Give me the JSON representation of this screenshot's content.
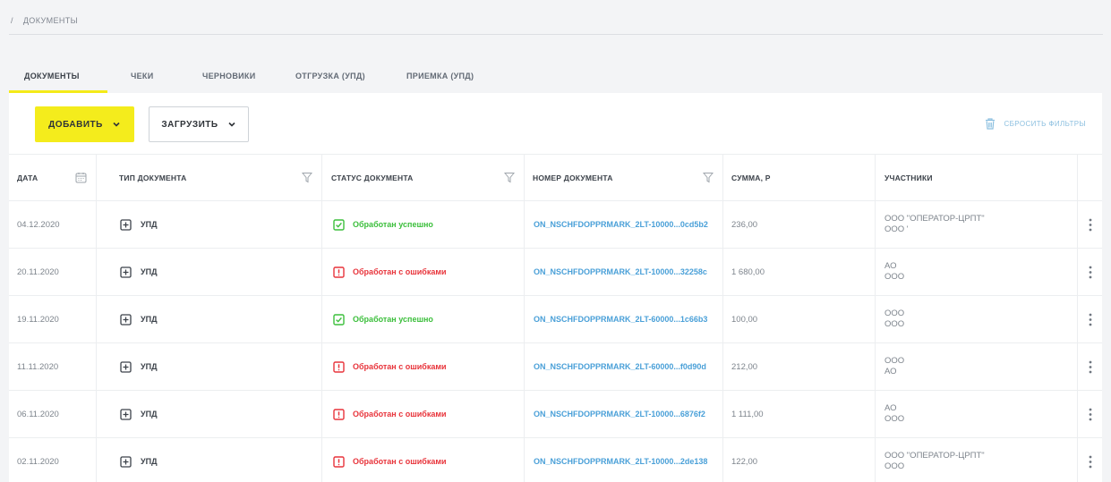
{
  "breadcrumb": {
    "separator": "/",
    "current": "ДОКУМЕНТЫ"
  },
  "tabs": [
    {
      "label": "ДОКУМЕНТЫ",
      "active": true
    },
    {
      "label": "ЧЕКИ",
      "active": false
    },
    {
      "label": "ЧЕРНОВИКИ",
      "active": false
    },
    {
      "label": "ОТГРУЗКА (УПД)",
      "active": false
    },
    {
      "label": "ПРИЕМКА (УПД)",
      "active": false
    }
  ],
  "toolbar": {
    "add_label": "ДОБАВИТЬ",
    "load_label": "ЗАГРУЗИТЬ",
    "reset_label": "СБРОСИТЬ ФИЛЬТРЫ"
  },
  "columns": {
    "date": "ДАТА",
    "type": "ТИП ДОКУМЕНТА",
    "status": "СТАТУС ДОКУМЕНТА",
    "number": "НОМЕР ДОКУМЕНТА",
    "sum": "СУММА, Р",
    "participants": "УЧАСТНИКИ"
  },
  "rows": [
    {
      "date": "04.12.2020",
      "type": "УПД",
      "status": "Обработан успешно",
      "status_kind": "ok",
      "number": "ON_NSCHFDOPPRMARK_2LT-10000...0cd5b2",
      "sum": "236,00",
      "p1": "ООО \"ОПЕРАТОР-ЦРПТ\"",
      "p2": "ООО '"
    },
    {
      "date": "20.11.2020",
      "type": "УПД",
      "status": "Обработан с ошибками",
      "status_kind": "error",
      "number": "ON_NSCHFDOPPRMARK_2LT-10000...32258c",
      "sum": "1 680,00",
      "p1": "АО",
      "p2": "ООО"
    },
    {
      "date": "19.11.2020",
      "type": "УПД",
      "status": "Обработан успешно",
      "status_kind": "ok",
      "number": "ON_NSCHFDOPPRMARK_2LT-60000...1c66b3",
      "sum": "100,00",
      "p1": "ООО",
      "p2": "ООО"
    },
    {
      "date": "11.11.2020",
      "type": "УПД",
      "status": "Обработан с ошибками",
      "status_kind": "error",
      "number": "ON_NSCHFDOPPRMARK_2LT-60000...f0d90d",
      "sum": "212,00",
      "p1": "ООО",
      "p2": "АО"
    },
    {
      "date": "06.11.2020",
      "type": "УПД",
      "status": "Обработан с ошибками",
      "status_kind": "error",
      "number": "ON_NSCHFDOPPRMARK_2LT-10000...6876f2",
      "sum": "1 111,00",
      "p1": "АО",
      "p2": "ООО"
    },
    {
      "date": "02.11.2020",
      "type": "УПД",
      "status": "Обработан с ошибками",
      "status_kind": "error",
      "number": "ON_NSCHFDOPPRMARK_2LT-10000...2de138",
      "sum": "122,00",
      "p1": "ООО \"ОПЕРАТОР-ЦРПТ\"",
      "p2": "ООО"
    }
  ],
  "colors": {
    "accent": "#f4ec1c",
    "ok": "#3cbf3c",
    "error": "#e8343b",
    "link": "#4aa0d8"
  },
  "icons": {
    "date_filter": "calendar-icon",
    "column_filter": "funnel-icon",
    "type": "plus-square-icon",
    "status_ok": "check-square-icon",
    "status_error": "exclamation-square-icon",
    "reset": "trash-icon",
    "row_menu": "more-vertical-icon",
    "dropdown": "chevron-down-icon"
  }
}
